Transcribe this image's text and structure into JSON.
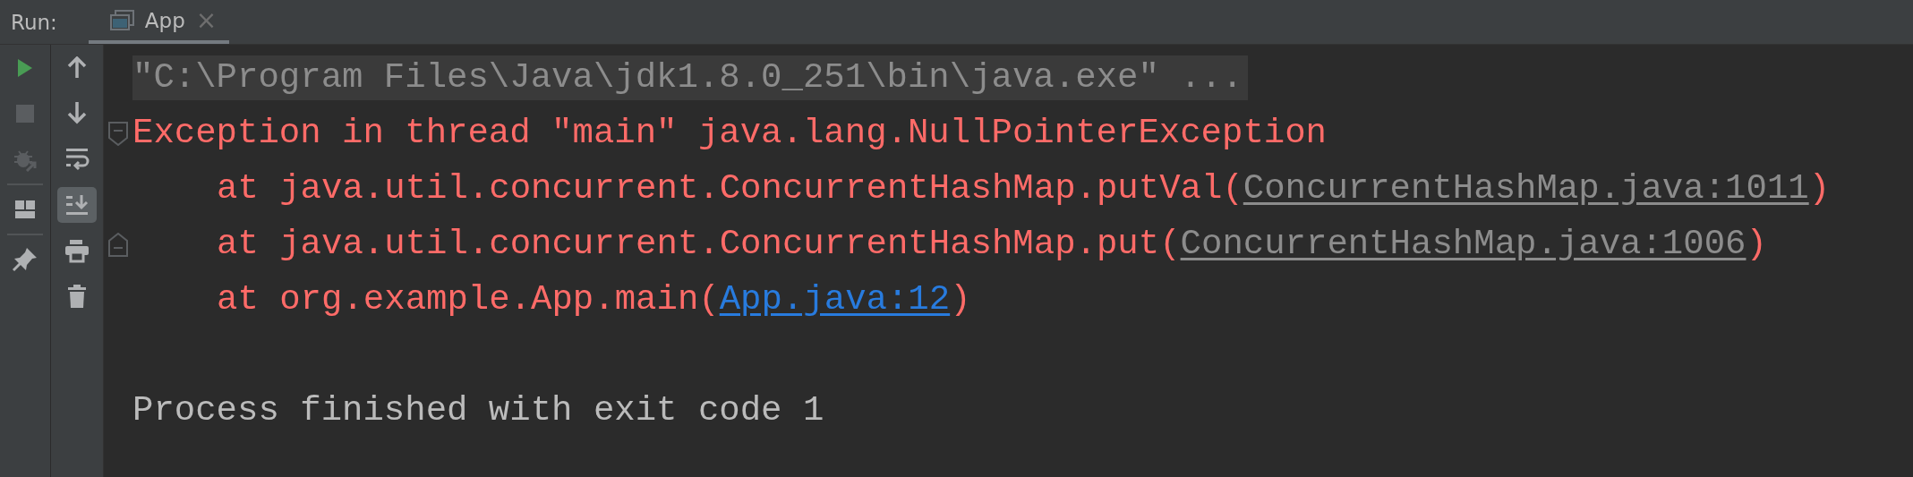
{
  "run_bar": {
    "label": "Run:",
    "tabs": [
      {
        "label": "App",
        "selected": true,
        "close": "×"
      }
    ]
  },
  "left_toolbar": [
    {
      "disabled": false
    },
    {
      "disabled": true
    },
    {
      "disabled": true
    },
    {
      "disabled": false
    },
    {
      "disabled": false
    }
  ],
  "console_toolbar": [
    {
      "selected": false
    },
    {
      "selected": false
    },
    {
      "selected": false
    },
    {
      "selected": true
    },
    {
      "selected": false
    },
    {
      "selected": false
    }
  ],
  "console": {
    "lines": [
      {
        "kind": "command",
        "parts": [
          {
            "kind": "text",
            "text": "\"C:\\Program Files\\Java\\jdk1.8.0_251\\bin\\java.exe\" ..."
          }
        ]
      },
      {
        "kind": "error",
        "fold": {
          "kind": "start"
        },
        "parts": [
          {
            "kind": "text",
            "text": "Exception in thread \"main\" java.lang.NullPointerException"
          }
        ]
      },
      {
        "kind": "frame",
        "parts": [
          {
            "kind": "text",
            "text": "at java.util.concurrent.ConcurrentHashMap.putVal("
          },
          {
            "kind": "link",
            "color": "#8c8c8c",
            "text": "ConcurrentHashMap.java:1011"
          },
          {
            "kind": "text",
            "text": ")"
          }
        ]
      },
      {
        "kind": "frame",
        "fold": {
          "kind": "end"
        },
        "parts": [
          {
            "kind": "text",
            "text": "at java.util.concurrent.ConcurrentHashMap.put("
          },
          {
            "kind": "link",
            "color": "#8c8c8c",
            "text": "ConcurrentHashMap.java:1006"
          },
          {
            "kind": "text",
            "text": ")"
          }
        ]
      },
      {
        "kind": "frame",
        "parts": [
          {
            "kind": "text",
            "text": "at org.example.App.main("
          },
          {
            "kind": "link",
            "color": "#287bde",
            "text": "App.java:12"
          },
          {
            "kind": "text",
            "text": ")"
          }
        ]
      },
      {
        "kind": "blank"
      },
      {
        "kind": "output",
        "parts": [
          {
            "kind": "text",
            "text": "Process finished with exit code 1"
          }
        ]
      }
    ]
  }
}
